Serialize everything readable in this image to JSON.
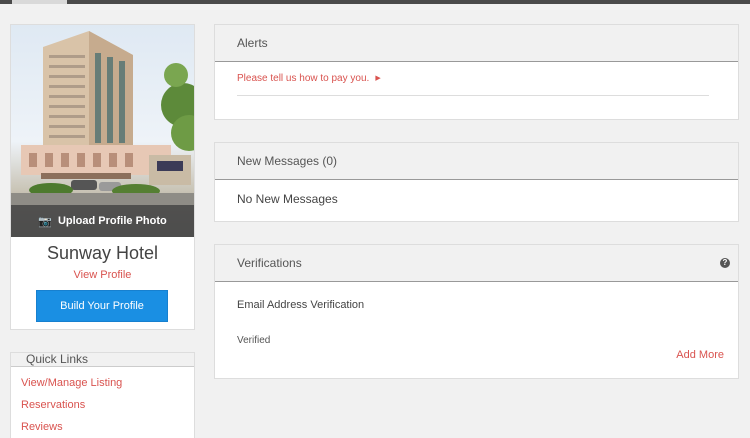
{
  "profile": {
    "upload_label": "Upload Profile Photo",
    "upload_icon": "camera-icon",
    "name": "Sunway Hotel",
    "view_profile": "View Profile",
    "build_profile": "Build Your Profile"
  },
  "quick_links": {
    "title": "Quick Links",
    "items": [
      "View/Manage Listing",
      "Reservations",
      "Reviews"
    ]
  },
  "alerts": {
    "title": "Alerts",
    "items": [
      "Please tell us how to pay you."
    ]
  },
  "messages": {
    "title": "New Messages (0)",
    "empty": "No New Messages"
  },
  "verifications": {
    "title": "Verifications",
    "help_icon": "question-circle-icon",
    "item_label": "Email Address Verification",
    "item_status": "Verified",
    "add_more": "Add More"
  },
  "colors": {
    "accent_link": "#d9534f",
    "primary_button": "#1a8fe3",
    "panel_header": "#f1f1f1"
  }
}
